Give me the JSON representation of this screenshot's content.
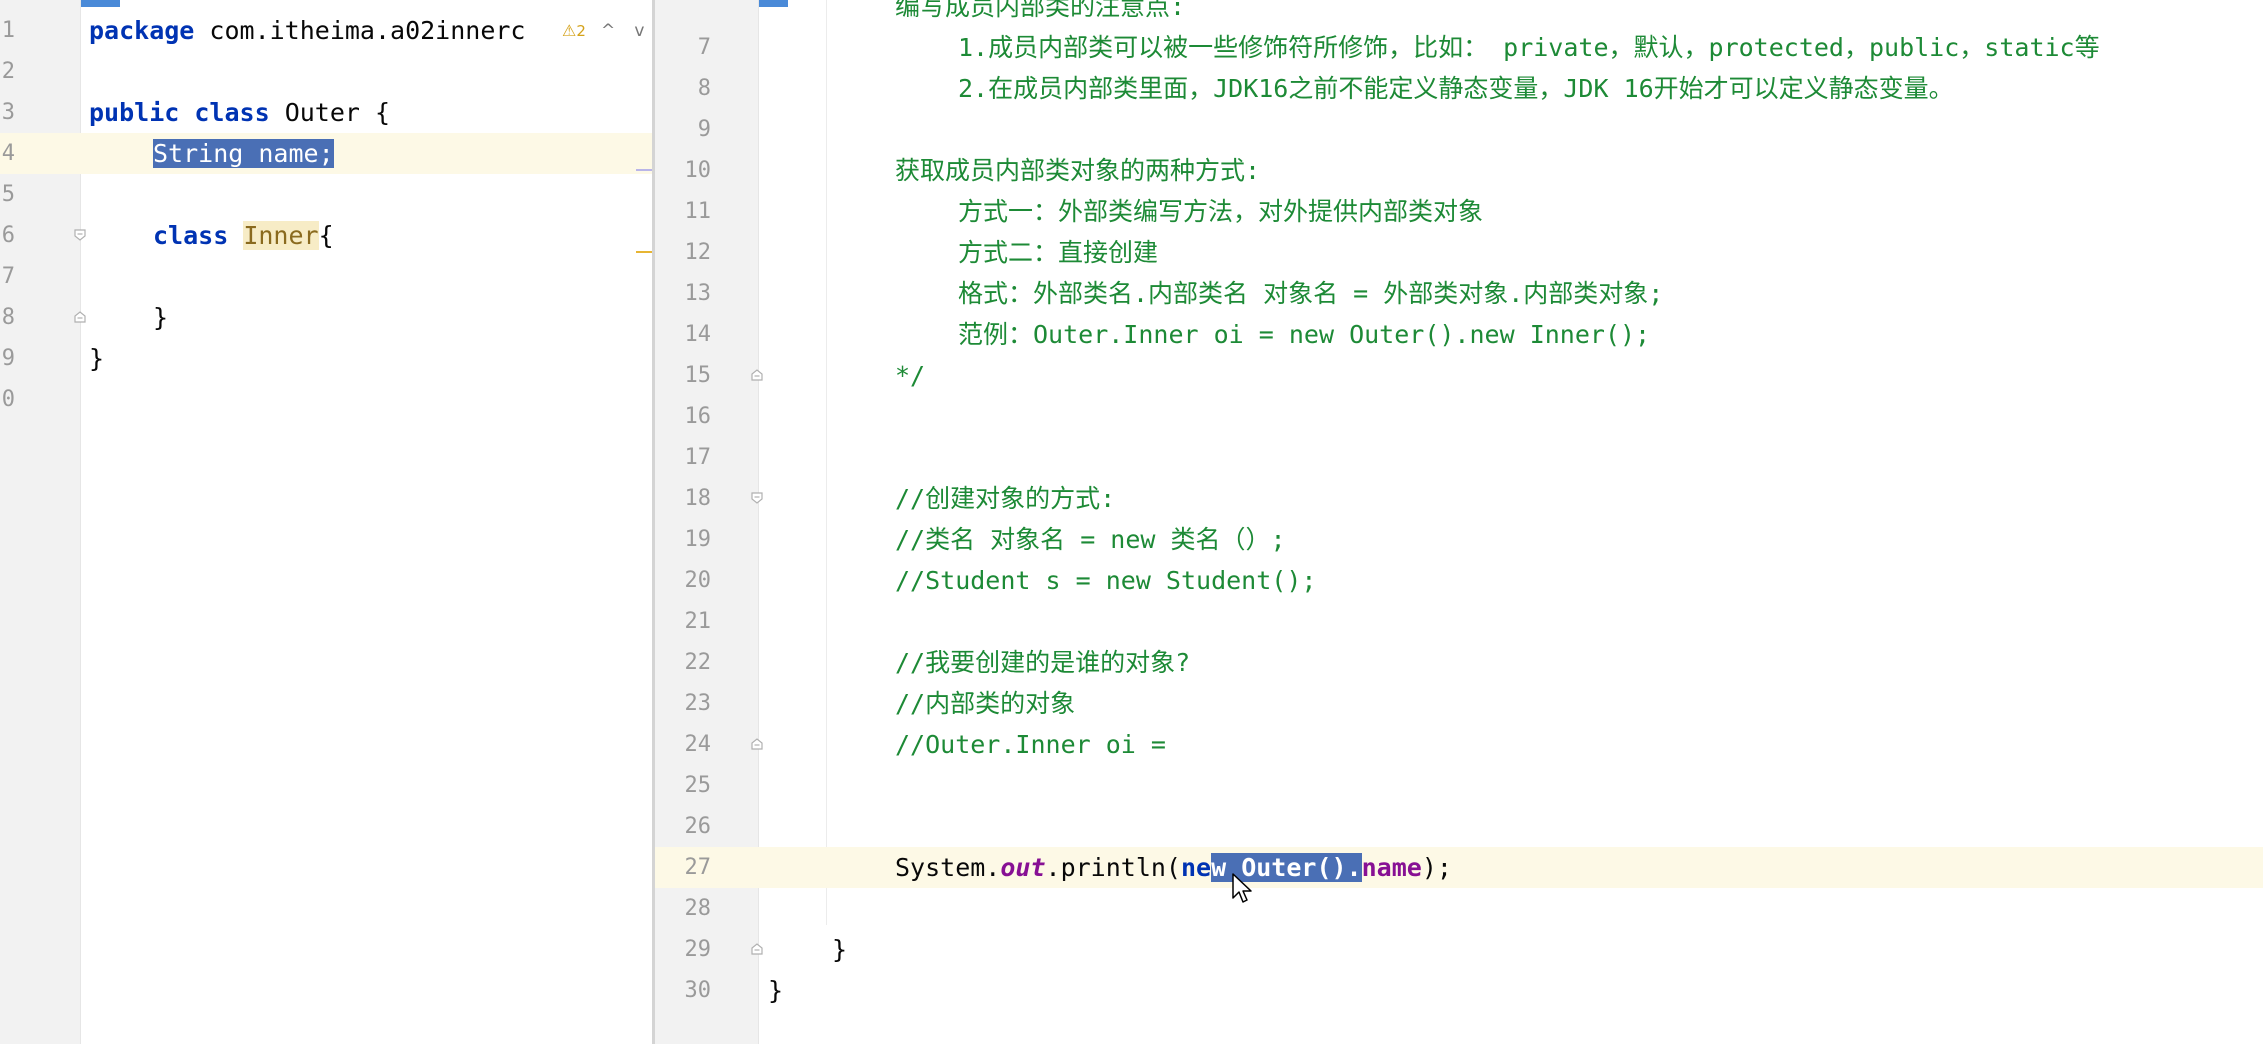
{
  "colors": {
    "keyword": "#0033b3",
    "comment": "#1d8a36",
    "field": "#871094",
    "selection": "#4a6fb5",
    "current_line": "#fdf9e6",
    "gutter": "#f2f2f2",
    "tab_active": "#4a8ad8",
    "warning": "#d4a21a"
  },
  "left_editor": {
    "warning_count": "2",
    "nav_up": "^",
    "nav_down": "v",
    "lines": [
      {
        "num": "1",
        "p": [
          "package",
          " com.itheima.a02innerc"
        ]
      },
      {
        "num": "2",
        "p": []
      },
      {
        "num": "3",
        "p": [
          "public",
          " ",
          "class",
          " Outer {"
        ]
      },
      {
        "num": "4",
        "p": [
          "String name;"
        ]
      },
      {
        "num": "5",
        "p": []
      },
      {
        "num": "6",
        "p": [
          "class",
          " ",
          "Inner",
          "{"
        ]
      },
      {
        "num": "7",
        "p": []
      },
      {
        "num": "8",
        "p": [
          "}"
        ]
      },
      {
        "num": "9",
        "p": [
          "}"
        ]
      },
      {
        "num": "0",
        "p": []
      }
    ]
  },
  "right_editor": {
    "partial_top": "编写成员内部类的注意点:",
    "lines": [
      {
        "num": "7",
        "p": [
          "1.成员内部类可以被一些修饰符所修饰，比如： private，默认，protected，public，static等"
        ]
      },
      {
        "num": "8",
        "p": [
          "2.在成员内部类里面，JDK16之前不能定义静态变量，JDK 16开始才可以定义静态变量。"
        ]
      },
      {
        "num": "9",
        "p": []
      },
      {
        "num": "10",
        "p": [
          "获取成员内部类对象的两种方式:"
        ]
      },
      {
        "num": "11",
        "p": [
          "方式一：外部类编写方法，对外提供内部类对象"
        ]
      },
      {
        "num": "12",
        "p": [
          "方式二：直接创建"
        ]
      },
      {
        "num": "13",
        "p": [
          "格式：外部类名.内部类名 对象名 = 外部类对象.内部类对象;"
        ]
      },
      {
        "num": "14",
        "p": [
          "范例：Outer.Inner oi = new Outer().new Inner();"
        ]
      },
      {
        "num": "15",
        "p": [
          "*/"
        ]
      },
      {
        "num": "16",
        "p": []
      },
      {
        "num": "17",
        "p": []
      },
      {
        "num": "18",
        "p": [
          "//创建对象的方式:"
        ]
      },
      {
        "num": "19",
        "p": [
          "//类名 对象名 = new 类名（）;"
        ]
      },
      {
        "num": "20",
        "p": [
          "//Student s = new Student();"
        ]
      },
      {
        "num": "21",
        "p": []
      },
      {
        "num": "22",
        "p": [
          "//我要创建的是谁的对象?"
        ]
      },
      {
        "num": "23",
        "p": [
          "//内部类的对象"
        ]
      },
      {
        "num": "24",
        "p": [
          "//Outer.Inner oi ="
        ]
      },
      {
        "num": "25",
        "p": []
      },
      {
        "num": "26",
        "p": []
      },
      {
        "num": "27",
        "p": [
          "System.",
          "out",
          ".println(",
          "ne",
          "w Outer().",
          "name",
          ");"
        ]
      },
      {
        "num": "28",
        "p": []
      },
      {
        "num": "29",
        "p": [
          "}"
        ]
      },
      {
        "num": "30",
        "p": [
          "}"
        ]
      }
    ]
  }
}
